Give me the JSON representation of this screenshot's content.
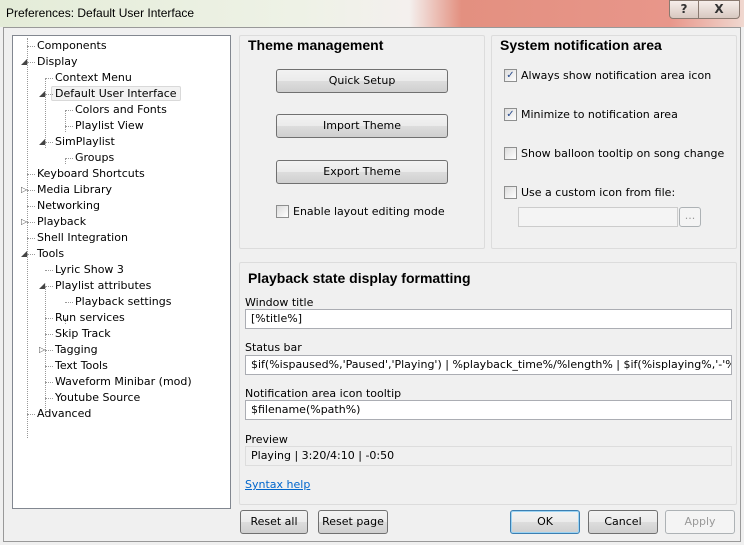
{
  "window": {
    "title": "Preferences: Default User Interface",
    "help_label": "?",
    "close_label": "X"
  },
  "tree": [
    {
      "label": "Components",
      "level": 0,
      "toggle": ""
    },
    {
      "label": "Display",
      "level": 0,
      "toggle": "open"
    },
    {
      "label": "Context Menu",
      "level": 1,
      "toggle": ""
    },
    {
      "label": "Default User Interface",
      "level": 1,
      "toggle": "open",
      "selected": true
    },
    {
      "label": "Colors and Fonts",
      "level": 2,
      "toggle": ""
    },
    {
      "label": "Playlist View",
      "level": 2,
      "toggle": ""
    },
    {
      "label": "SimPlaylist",
      "level": 1,
      "toggle": "open"
    },
    {
      "label": "Groups",
      "level": 2,
      "toggle": ""
    },
    {
      "label": "Keyboard Shortcuts",
      "level": 0,
      "toggle": ""
    },
    {
      "label": "Media Library",
      "level": 0,
      "toggle": "closed"
    },
    {
      "label": "Networking",
      "level": 0,
      "toggle": ""
    },
    {
      "label": "Playback",
      "level": 0,
      "toggle": "closed"
    },
    {
      "label": "Shell Integration",
      "level": 0,
      "toggle": ""
    },
    {
      "label": "Tools",
      "level": 0,
      "toggle": "open"
    },
    {
      "label": "Lyric Show 3",
      "level": 1,
      "toggle": ""
    },
    {
      "label": "Playlist attributes",
      "level": 1,
      "toggle": "open"
    },
    {
      "label": "Playback settings",
      "level": 2,
      "toggle": ""
    },
    {
      "label": "Run services",
      "level": 1,
      "toggle": ""
    },
    {
      "label": "Skip Track",
      "level": 1,
      "toggle": ""
    },
    {
      "label": "Tagging",
      "level": 1,
      "toggle": "closed"
    },
    {
      "label": "Text Tools",
      "level": 1,
      "toggle": ""
    },
    {
      "label": "Waveform Minibar (mod)",
      "level": 1,
      "toggle": ""
    },
    {
      "label": "Youtube Source",
      "level": 1,
      "toggle": ""
    },
    {
      "label": "Advanced",
      "level": 0,
      "toggle": ""
    }
  ],
  "theme": {
    "heading": "Theme management",
    "quick_setup": "Quick Setup",
    "import": "Import Theme",
    "export": "Export Theme",
    "layout_editing": "Enable layout editing mode",
    "layout_editing_checked": false
  },
  "notify": {
    "heading": "System notification area",
    "always_show": "Always show notification area icon",
    "always_show_checked": true,
    "minimize": "Minimize to notification area",
    "minimize_checked": true,
    "balloon": "Show balloon tooltip on song change",
    "balloon_checked": false,
    "custom_icon": "Use a custom icon from file:",
    "custom_icon_checked": false,
    "custom_icon_path": "",
    "browse_label": "..."
  },
  "playback": {
    "heading": "Playback state display formatting",
    "window_title_label": "Window title",
    "window_title": "[%title%]",
    "status_bar_label": "Status bar",
    "status_bar": "$if(%ispaused%,'Paused','Playing') | %playback_time%/%length% | $if(%isplaying%,'-'%playback_time_remaining%,)",
    "tooltip_label": "Notification area icon tooltip",
    "tooltip": "$filename(%path%)",
    "preview_label": "Preview",
    "preview": "Playing | 3:20/4:10 | -0:50",
    "syntax_help": "Syntax help"
  },
  "buttons": {
    "reset_all": "Reset all",
    "reset_page": "Reset page",
    "ok": "OK",
    "cancel": "Cancel",
    "apply": "Apply"
  }
}
